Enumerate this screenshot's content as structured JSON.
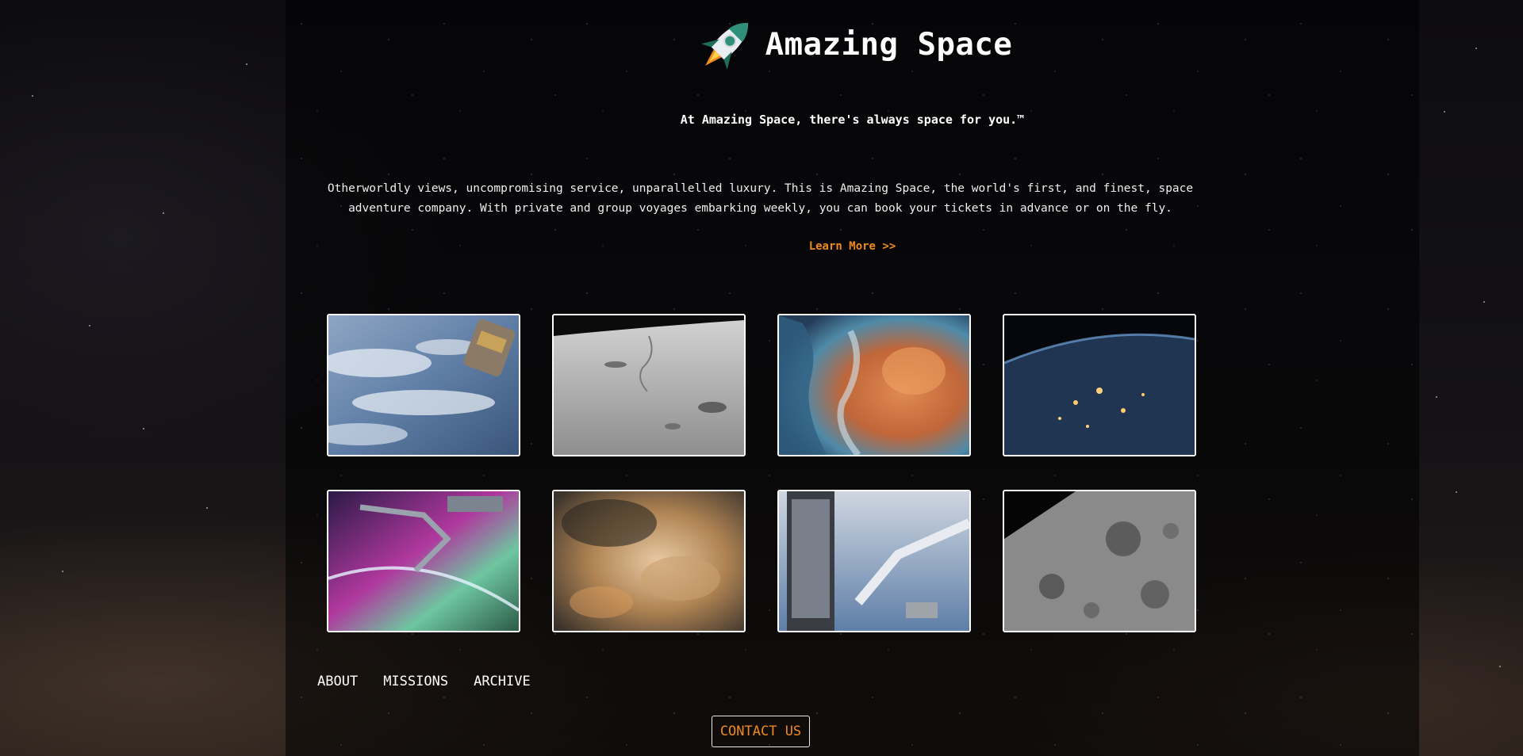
{
  "header": {
    "title": "Amazing Space",
    "logo_icon": "rocket-icon"
  },
  "intro": {
    "tagline": "At Amazing Space, there's always space for you.™",
    "description": "Otherworldly views, uncompromising service, unparallelled luxury. This is Amazing Space, the world's first, and finest, space adventure company. With private and group voyages embarking weekly, you can book your tickets in advance or on the fly.",
    "learn_more": "Learn More >>"
  },
  "gallery": {
    "images": [
      "earth-clouds-spacecraft",
      "lunar-surface",
      "colorful-nebula",
      "earth-night-lights",
      "aurora-robotic-arm",
      "orion-nebula",
      "hubble-telescope-servicing",
      "moon-craters"
    ]
  },
  "nav": {
    "items": [
      "ABOUT",
      "MISSIONS",
      "ARCHIVE"
    ]
  },
  "footer": {
    "contact_label": "CONTACT US"
  },
  "colors": {
    "accent": "#f08a1c",
    "text": "#ffffff",
    "panel": "#000000"
  }
}
